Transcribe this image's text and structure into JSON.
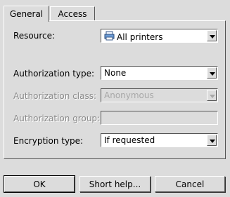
{
  "tabs": [
    {
      "label": "General",
      "active": true
    },
    {
      "label": "Access",
      "active": false
    }
  ],
  "form": {
    "resource": {
      "label": "Resource:",
      "value": "All printers",
      "icon": "printer-icon"
    },
    "auth_type": {
      "label": "Authorization type:",
      "value": "None"
    },
    "auth_class": {
      "label": "Authorization class:",
      "value": "Anonymous",
      "disabled": true
    },
    "auth_group": {
      "label": "Authorization group:",
      "value": "",
      "disabled": true
    },
    "encryption": {
      "label": "Encryption type:",
      "value": "If requested"
    }
  },
  "buttons": {
    "ok": "OK",
    "help": "Short help...",
    "cancel": "Cancel"
  }
}
